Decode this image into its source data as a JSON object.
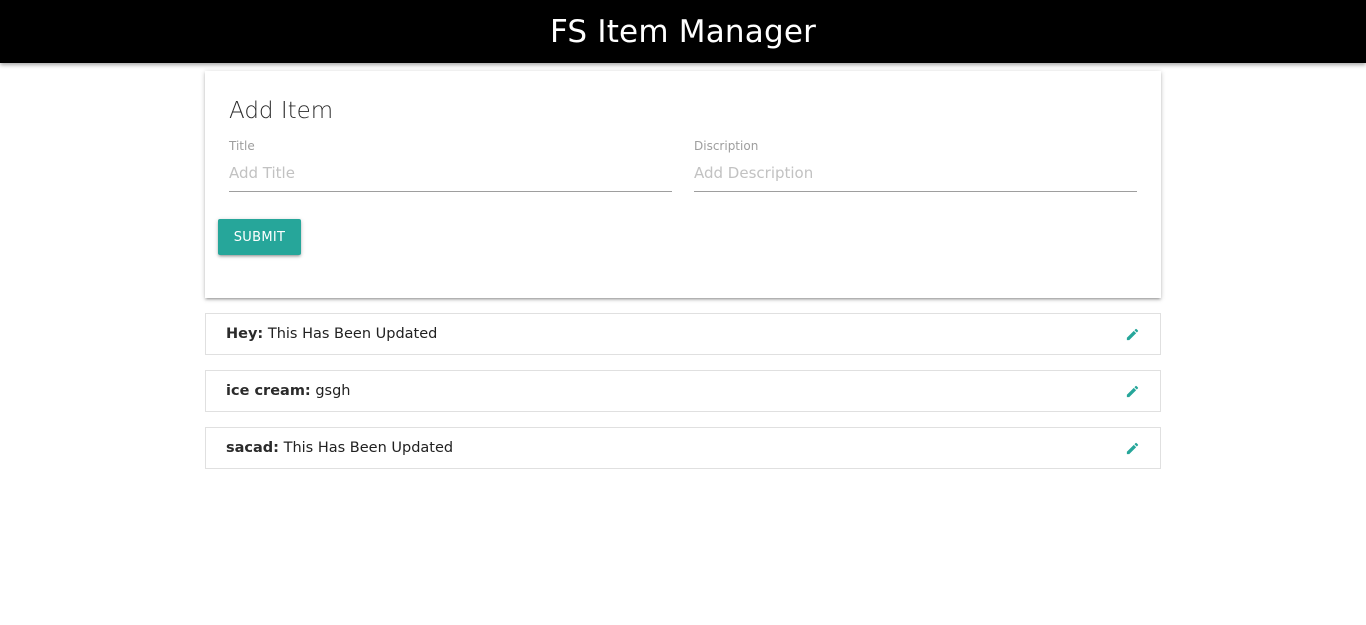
{
  "navbar": {
    "brand": "FS Item Manager"
  },
  "add_form": {
    "heading": "Add Item",
    "title_label": "Title",
    "title_placeholder": "Add Title",
    "title_value": "",
    "description_label": "Discription",
    "description_placeholder": "Add Description",
    "description_value": "",
    "submit_label": "SUBMIT"
  },
  "items": [
    {
      "title": "Hey:",
      "description": " This Has Been Updated",
      "icon": "pencil-icon"
    },
    {
      "title": "ice cream:",
      "description": " gsgh",
      "icon": "pencil-icon"
    },
    {
      "title": "sacad:",
      "description": " This Has Been Updated",
      "icon": "pencil-icon"
    }
  ],
  "colors": {
    "navbar_bg": "#000000",
    "accent": "#26a69a",
    "edit_icon": "#26a69a"
  }
}
